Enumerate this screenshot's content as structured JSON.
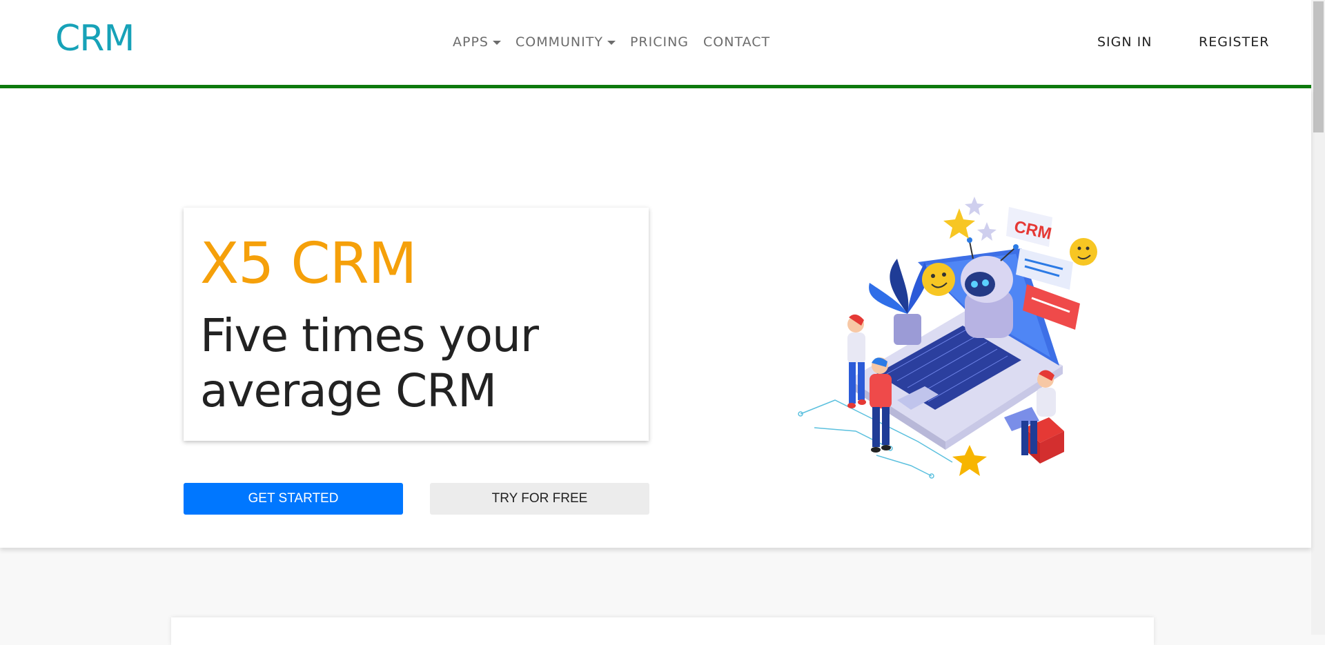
{
  "navbar": {
    "brand": "CRM",
    "items": [
      {
        "label": "APPS",
        "dropdown": true
      },
      {
        "label": "COMMUNITY",
        "dropdown": true
      },
      {
        "label": "PRICING",
        "dropdown": false
      },
      {
        "label": "CONTACT",
        "dropdown": false
      }
    ],
    "sign_in": "SIGN IN",
    "register": "REGISTER"
  },
  "hero": {
    "title": "X5 CRM",
    "subtitle": "Five times your average CRM",
    "get_started": "GET STARTED",
    "try_free": "TRY FOR FREE",
    "illustration_badge": "CRM"
  },
  "colors": {
    "brand": "#17a2b8",
    "accent_line": "#0d7a0d",
    "title": "#f5a00a",
    "primary_button": "#0077ff"
  }
}
